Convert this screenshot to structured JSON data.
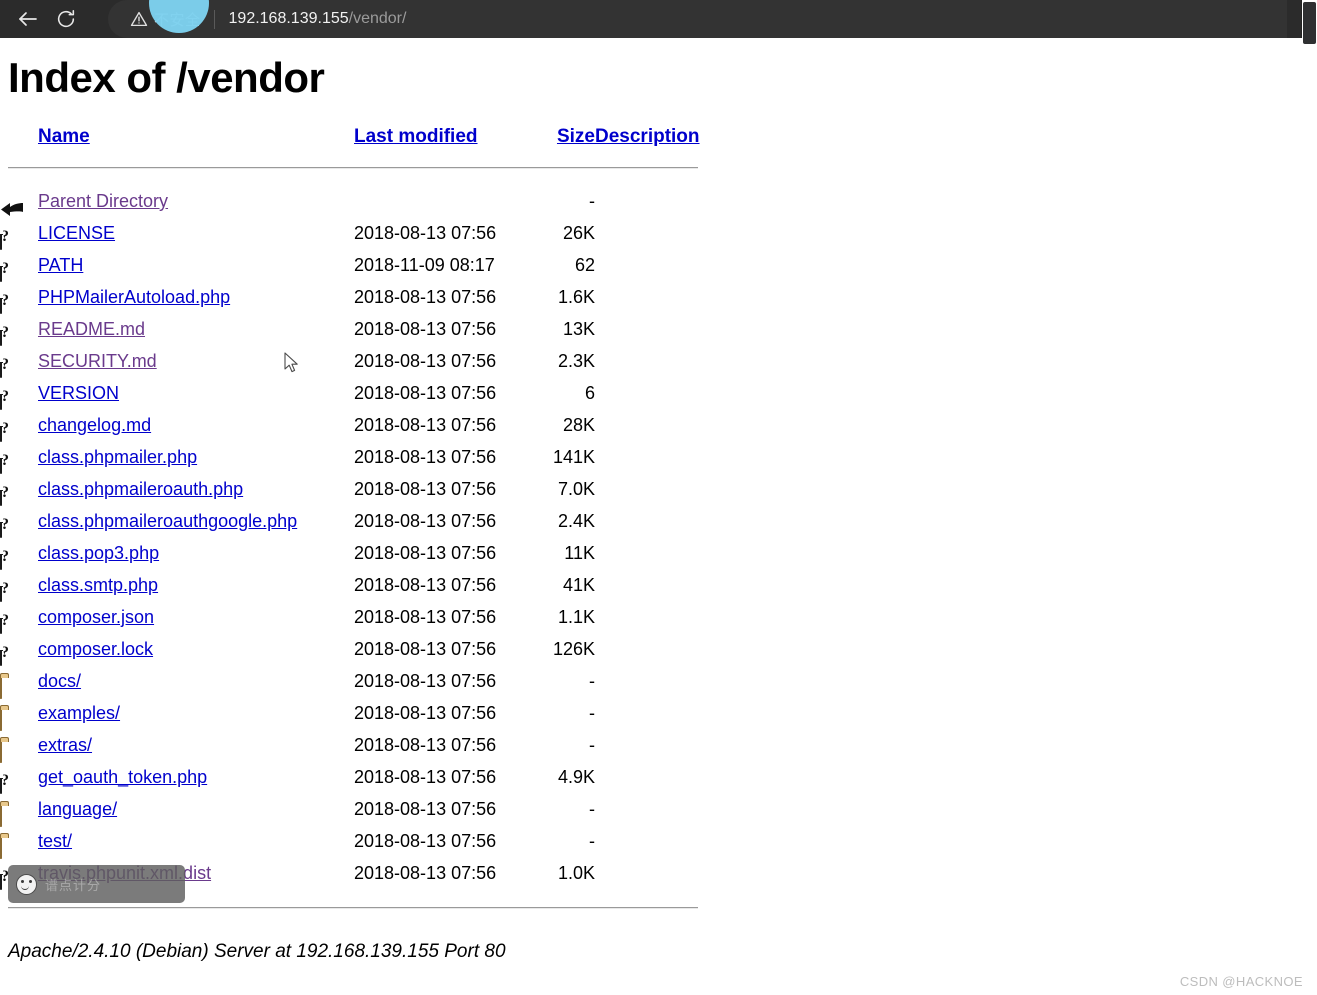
{
  "browser": {
    "back_label": "Back",
    "reload_label": "Reload",
    "security_label": "不安全",
    "url_host": "192.168.139.155",
    "url_path": "/vendor/"
  },
  "page": {
    "title": "Index of /vendor",
    "server_signature": "Apache/2.4.10 (Debian) Server at 192.168.139.155 Port 80"
  },
  "columns": {
    "name": "Name",
    "last_modified": "Last modified",
    "size": "Size",
    "description": "Description"
  },
  "rows": [
    {
      "icon": "back",
      "name": "Parent Directory",
      "visited": true,
      "date": "",
      "size": "-",
      "desc": ""
    },
    {
      "icon": "doc",
      "name": "LICENSE",
      "visited": false,
      "date": "2018-08-13 07:56",
      "size": "26K",
      "desc": ""
    },
    {
      "icon": "doc",
      "name": "PATH",
      "visited": false,
      "date": "2018-11-09 08:17",
      "size": "62",
      "desc": ""
    },
    {
      "icon": "doc",
      "name": "PHPMailerAutoload.php",
      "visited": false,
      "date": "2018-08-13 07:56",
      "size": "1.6K",
      "desc": ""
    },
    {
      "icon": "doc",
      "name": "README.md",
      "visited": true,
      "date": "2018-08-13 07:56",
      "size": "13K",
      "desc": ""
    },
    {
      "icon": "doc",
      "name": "SECURITY.md",
      "visited": true,
      "date": "2018-08-13 07:56",
      "size": "2.3K",
      "desc": ""
    },
    {
      "icon": "doc",
      "name": "VERSION",
      "visited": false,
      "date": "2018-08-13 07:56",
      "size": "6",
      "desc": ""
    },
    {
      "icon": "doc",
      "name": "changelog.md",
      "visited": false,
      "date": "2018-08-13 07:56",
      "size": "28K",
      "desc": ""
    },
    {
      "icon": "doc",
      "name": "class.phpmailer.php",
      "visited": false,
      "date": "2018-08-13 07:56",
      "size": "141K",
      "desc": ""
    },
    {
      "icon": "doc",
      "name": "class.phpmaileroauth.php",
      "visited": false,
      "date": "2018-08-13 07:56",
      "size": "7.0K",
      "desc": ""
    },
    {
      "icon": "doc",
      "name": "class.phpmaileroauthgoogle.php",
      "visited": false,
      "date": "2018-08-13 07:56",
      "size": "2.4K",
      "desc": ""
    },
    {
      "icon": "doc",
      "name": "class.pop3.php",
      "visited": false,
      "date": "2018-08-13 07:56",
      "size": "11K",
      "desc": ""
    },
    {
      "icon": "doc",
      "name": "class.smtp.php",
      "visited": false,
      "date": "2018-08-13 07:56",
      "size": "41K",
      "desc": ""
    },
    {
      "icon": "doc",
      "name": "composer.json",
      "visited": false,
      "date": "2018-08-13 07:56",
      "size": "1.1K",
      "desc": ""
    },
    {
      "icon": "doc",
      "name": "composer.lock",
      "visited": false,
      "date": "2018-08-13 07:56",
      "size": "126K",
      "desc": ""
    },
    {
      "icon": "folder",
      "name": "docs/",
      "visited": false,
      "date": "2018-08-13 07:56",
      "size": "-",
      "desc": ""
    },
    {
      "icon": "folder",
      "name": "examples/",
      "visited": false,
      "date": "2018-08-13 07:56",
      "size": "-",
      "desc": ""
    },
    {
      "icon": "folder",
      "name": "extras/",
      "visited": false,
      "date": "2018-08-13 07:56",
      "size": "-",
      "desc": ""
    },
    {
      "icon": "doc",
      "name": "get_oauth_token.php",
      "visited": false,
      "date": "2018-08-13 07:56",
      "size": "4.9K",
      "desc": ""
    },
    {
      "icon": "folder",
      "name": "language/",
      "visited": false,
      "date": "2018-08-13 07:56",
      "size": "-",
      "desc": ""
    },
    {
      "icon": "folder",
      "name": "test/",
      "visited": false,
      "date": "2018-08-13 07:56",
      "size": "-",
      "desc": ""
    },
    {
      "icon": "doc",
      "name": "travis.phpunit.xml.dist",
      "visited": true,
      "date": "2018-08-13 07:56",
      "size": "1.0K",
      "desc": ""
    }
  ],
  "ime_popup": {
    "text": "谱点计分"
  },
  "watermark": {
    "text": "CSDN @HACKNOE"
  },
  "colors": {
    "link": "#0000cc",
    "link_visited": "#6a3a8c",
    "chrome_bg": "#2b2b2b",
    "ripple": "#7ed2f0",
    "folder": "#e8c88c"
  }
}
